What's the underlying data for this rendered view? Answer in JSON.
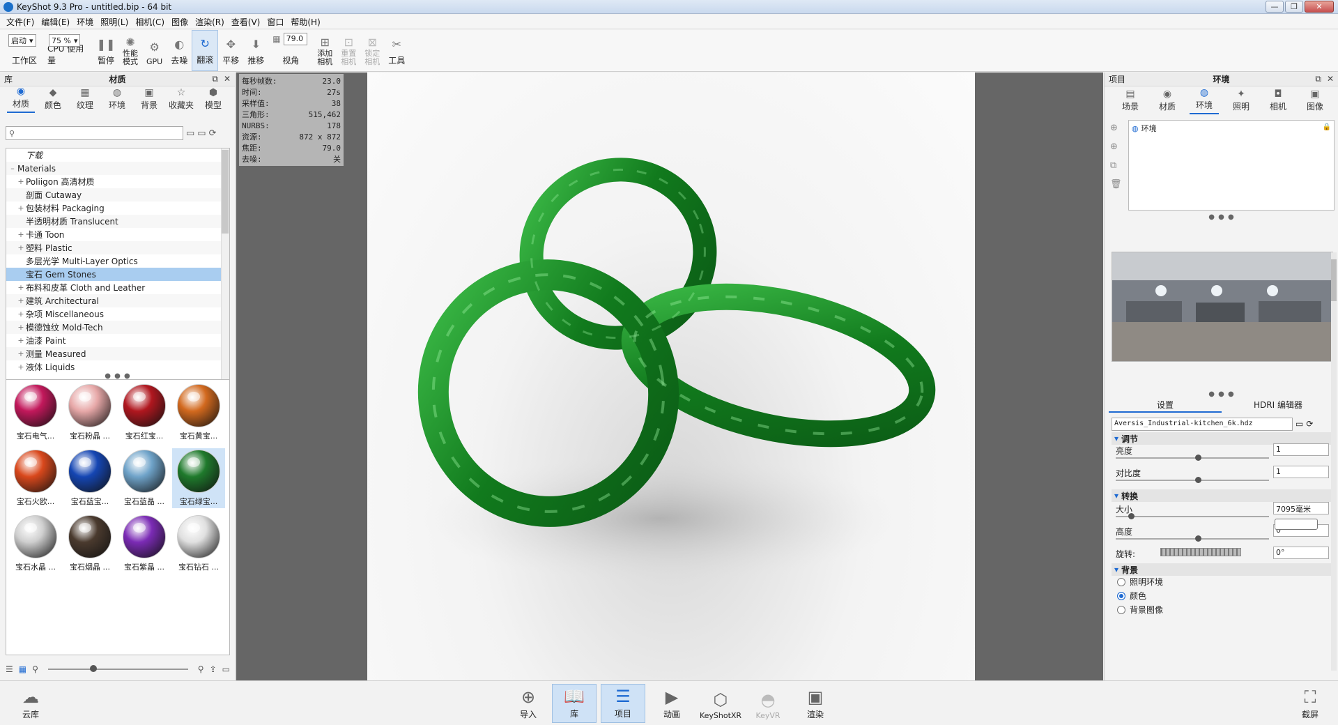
{
  "window": {
    "title": "KeyShot 9.3 Pro  - untitled.bip  - 64 bit",
    "min": "—",
    "max": "❐",
    "close": "✕"
  },
  "menu": [
    "文件(F)",
    "编辑(E)",
    "环境",
    "照明(L)",
    "相机(C)",
    "图像",
    "渲染(R)",
    "查看(V)",
    "窗口",
    "帮助(H)"
  ],
  "toolbar": {
    "workspace_select": "启动",
    "workspace_label": "工作区",
    "cpu_select": "75 %",
    "cpu_label": "CPU 使用量",
    "pause_label": "暂停",
    "perf_label": "性能\n模式",
    "gpu_label": "GPU",
    "denoise_label": "去噪",
    "tumble_label": "翻滚",
    "pan_label": "平移",
    "dolly_label": "推移",
    "fov_value": "79.0",
    "fov_label": "视角",
    "add_camera_label": "添加\n相机",
    "reset_camera_label": "重置\n相机",
    "lock_camera_label": "锁定\n相机",
    "tools_label": "工具"
  },
  "library": {
    "header_left": "库",
    "header_title": "材质",
    "tabs": [
      {
        "label": "材质",
        "icon": "material-icon"
      },
      {
        "label": "颜色",
        "icon": "color-icon"
      },
      {
        "label": "纹理",
        "icon": "texture-icon"
      },
      {
        "label": "环境",
        "icon": "environment-icon"
      },
      {
        "label": "背景",
        "icon": "background-icon"
      },
      {
        "label": "收藏夹",
        "icon": "favorites-icon"
      },
      {
        "label": "模型",
        "icon": "model-icon"
      }
    ],
    "search_placeholder": "",
    "tree": [
      {
        "label": "下载",
        "exp": "",
        "indent": 1,
        "italic": true
      },
      {
        "label": "Materials",
        "exp": "–",
        "indent": 0
      },
      {
        "label": "Poliigon 高清材质",
        "exp": "+",
        "indent": 1
      },
      {
        "label": "剖面 Cutaway",
        "exp": "",
        "indent": 1
      },
      {
        "label": "包装材料 Packaging",
        "exp": "+",
        "indent": 1
      },
      {
        "label": "半透明材质 Translucent",
        "exp": "",
        "indent": 1
      },
      {
        "label": "卡通 Toon",
        "exp": "+",
        "indent": 1
      },
      {
        "label": "塑料 Plastic",
        "exp": "+",
        "indent": 1
      },
      {
        "label": "多层光学 Multi-Layer Optics",
        "exp": "",
        "indent": 1
      },
      {
        "label": "宝石 Gem Stones",
        "exp": "",
        "indent": 1,
        "selected": true
      },
      {
        "label": "布料和皮革 Cloth and Leather",
        "exp": "+",
        "indent": 1
      },
      {
        "label": "建筑 Architectural",
        "exp": "+",
        "indent": 1
      },
      {
        "label": "杂项 Miscellaneous",
        "exp": "+",
        "indent": 1
      },
      {
        "label": "模德蚀纹 Mold-Tech",
        "exp": "+",
        "indent": 1
      },
      {
        "label": "油漆 Paint",
        "exp": "+",
        "indent": 1
      },
      {
        "label": "测量 Measured",
        "exp": "+",
        "indent": 1
      },
      {
        "label": "液体 Liquids",
        "exp": "+",
        "indent": 1
      }
    ],
    "materials": [
      {
        "label": "宝石电气...",
        "color": "#c2185b"
      },
      {
        "label": "宝石粉晶 ...",
        "color": "#e7a8a8"
      },
      {
        "label": "宝石红宝...",
        "color": "#b0171f"
      },
      {
        "label": "宝石黄宝...",
        "color": "#d2691e"
      },
      {
        "label": "宝石火欧...",
        "color": "#d9481c"
      },
      {
        "label": "宝石蓝宝...",
        "color": "#1546b3"
      },
      {
        "label": "宝石蓝晶 ...",
        "color": "#6fa3c9"
      },
      {
        "label": "宝石绿宝...",
        "color": "#1f7a2c",
        "selected": true
      },
      {
        "label": "宝石水晶 ...",
        "color": "#cfcfcf"
      },
      {
        "label": "宝石烟晶 ...",
        "color": "#4a3a2e"
      },
      {
        "label": "宝石紫晶 ...",
        "color": "#7b2bb5"
      },
      {
        "label": "宝石钻石 ...",
        "color": "#e0e0e0"
      }
    ]
  },
  "stats": [
    {
      "k": "每秒帧数:",
      "v": "23.0"
    },
    {
      "k": "时间:",
      "v": "27s"
    },
    {
      "k": "采样值:",
      "v": "38"
    },
    {
      "k": "三角形:",
      "v": "515,462"
    },
    {
      "k": "NURBS:",
      "v": "178"
    },
    {
      "k": "资源:",
      "v": "872 x 872"
    },
    {
      "k": "焦距:",
      "v": "79.0"
    },
    {
      "k": "去噪:",
      "v": "关"
    }
  ],
  "project": {
    "header_left": "项目",
    "header_title": "环境",
    "tabs": [
      {
        "label": "场景",
        "icon": "scene-icon"
      },
      {
        "label": "材质",
        "icon": "material-icon"
      },
      {
        "label": "环境",
        "icon": "environment-icon"
      },
      {
        "label": "照明",
        "icon": "lighting-icon"
      },
      {
        "label": "相机",
        "icon": "camera-icon"
      },
      {
        "label": "图像",
        "icon": "image-icon"
      }
    ],
    "env_item": "环境",
    "subtabs": [
      "设置",
      "HDRI 编辑器"
    ],
    "hdri_file": "Aversis_Industrial-kitchen_6k.hdz",
    "sections": {
      "adjust": "调节",
      "transform": "转换",
      "background": "背景"
    },
    "props": {
      "brightness_label": "亮度",
      "brightness_value": "1",
      "contrast_label": "对比度",
      "contrast_value": "1",
      "size_label": "大小",
      "size_value": "7095毫米",
      "height_label": "高度",
      "height_value": "0",
      "rotation_label": "旋转:",
      "rotation_value": "0°"
    },
    "background_options": [
      "照明环境",
      "颜色",
      "背景图像"
    ],
    "background_selected": 1
  },
  "bottom": {
    "cloud": "云库",
    "import": "导入",
    "library": "库",
    "project": "项目",
    "animation": "动画",
    "keyshotxr": "KeyShotXR",
    "keyvr": "KeyVR",
    "render": "渲染",
    "screenshot": "截屏"
  },
  "colors": {
    "accent": "#1e6ad2",
    "viewport_bg": "#666666"
  }
}
